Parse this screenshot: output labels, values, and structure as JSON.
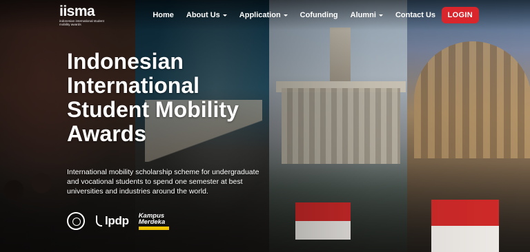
{
  "brand": {
    "logo_word": "iisma",
    "logo_sub": "indonesian international student mobility awards"
  },
  "nav": {
    "items": [
      {
        "label": "Home",
        "has_dropdown": false
      },
      {
        "label": "About Us",
        "has_dropdown": true
      },
      {
        "label": "Application",
        "has_dropdown": true
      },
      {
        "label": "Cofunding",
        "has_dropdown": false
      },
      {
        "label": "Alumni",
        "has_dropdown": true
      },
      {
        "label": "Contact Us",
        "has_dropdown": false
      }
    ],
    "login_label": "LOGIN"
  },
  "hero": {
    "title_lines": [
      "Indonesian",
      "International",
      "Student Mobility",
      "Awards"
    ],
    "description": "International mobility scholarship scheme for undergraduate and vocational students to spend one semester at best universities and industries around the world."
  },
  "partners": {
    "lpdp": "lpdp",
    "kampus_line1": "Kampus",
    "kampus_line2": "Merdeka"
  },
  "colors": {
    "login_bg": "#d9262d",
    "text": "#ffffff",
    "kampus_accent": "#f2c300"
  }
}
